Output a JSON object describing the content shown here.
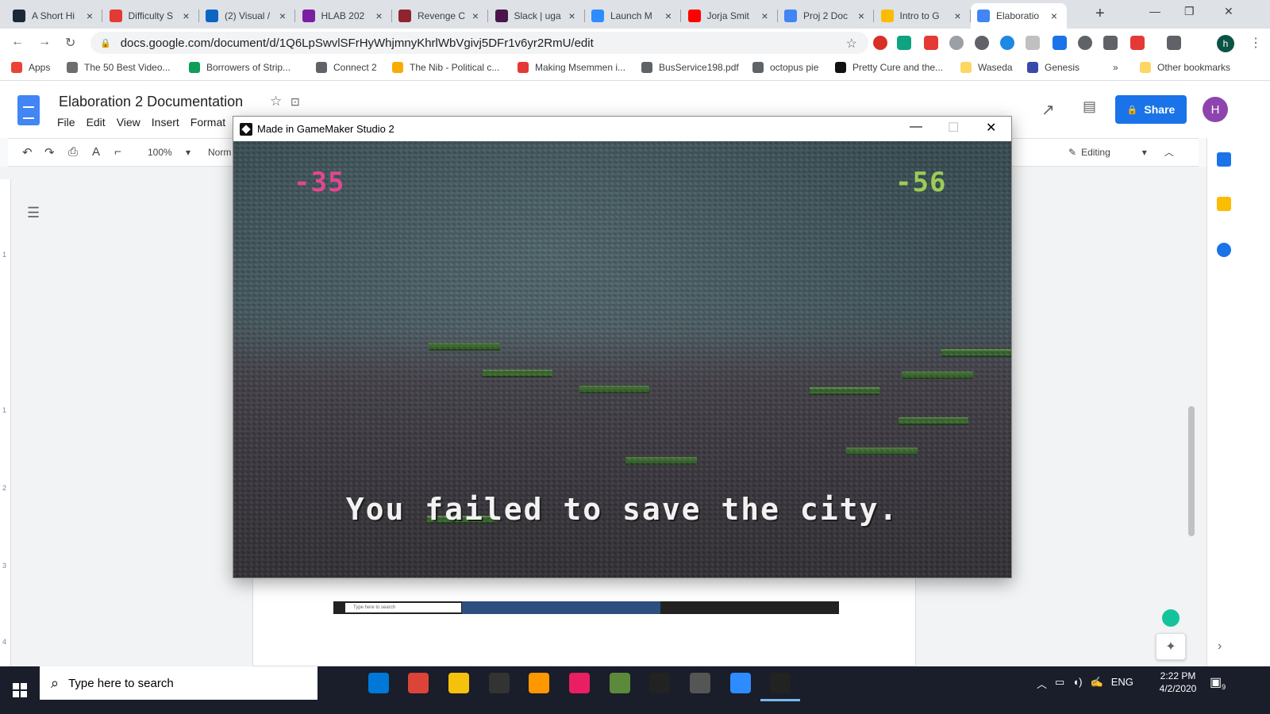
{
  "browser": {
    "tabs": [
      {
        "label": "A Short Hi",
        "icon": "steam-icon",
        "color": "#1b2838",
        "active": false
      },
      {
        "label": "Difficulty S",
        "icon": "sketchy-icon",
        "color": "#e53935",
        "active": false
      },
      {
        "label": "(2) Visual /",
        "icon": "linkedin-icon",
        "color": "#0a66c2",
        "active": false
      },
      {
        "label": "HLAB 202",
        "icon": "onenote-icon",
        "color": "#7b1fa2",
        "active": false
      },
      {
        "label": "Revenge C",
        "icon": "bookmark-icon",
        "color": "#8e2430",
        "active": false
      },
      {
        "label": "Slack | uga",
        "icon": "slack-icon",
        "color": "#4a154b",
        "active": false
      },
      {
        "label": "Launch M",
        "icon": "zoom-icon",
        "color": "#2d8cff",
        "active": false
      },
      {
        "label": "Jorja Smit",
        "icon": "youtube-icon",
        "color": "#ff0000",
        "active": false
      },
      {
        "label": "Proj 2 Doc",
        "icon": "docs-icon",
        "color": "#4285f4",
        "active": false
      },
      {
        "label": "Intro to G",
        "icon": "drive-icon",
        "color": "#fbbc04",
        "active": false
      },
      {
        "label": "Elaboratio",
        "icon": "docs-icon",
        "color": "#4285f4",
        "active": true
      }
    ],
    "url": "docs.google.com/document/d/1Q6LpSwvlSFrHyWhjmnyKhrlWbVgivj5DFr1v6yr2RmU/edit",
    "bookmarks": [
      {
        "label": "Apps",
        "color": "#ea4335"
      },
      {
        "label": "The 50 Best Video...",
        "color": "#6d6d6d"
      },
      {
        "label": "Borrowers of Strip...",
        "color": "#0f9d58"
      },
      {
        "label": "Connect 2",
        "color": "#5f6368"
      },
      {
        "label": "The Nib - Political c...",
        "color": "#f9ab00"
      },
      {
        "label": "Making Msemmen i...",
        "color": "#e53935"
      },
      {
        "label": "BusService198.pdf",
        "color": "#5f6368"
      },
      {
        "label": "octopus pie",
        "color": "#5f6368"
      },
      {
        "label": "Pretty Cure and the...",
        "color": "#111111"
      },
      {
        "label": "Waseda",
        "color": "#fdd663"
      },
      {
        "label": "Genesis",
        "color": "#3949ab"
      }
    ],
    "bookmarks_more": "»",
    "other_bookmarks": "Other bookmarks",
    "profile_initial": "h"
  },
  "docs": {
    "title": "Elaboration 2 Documentation",
    "menu": [
      "File",
      "Edit",
      "View",
      "Insert",
      "Format"
    ],
    "zoom": "100%",
    "style": "Norm",
    "mode": "Editing",
    "share_label": "Share",
    "avatar_initial": "H",
    "ruler_numbers": [
      "1",
      "1",
      "2",
      "3",
      "4"
    ],
    "embedded_search_placeholder": "Type here to search"
  },
  "game": {
    "window_title": "Made in GameMaker Studio 2",
    "score_left": "-35",
    "score_right": "-56",
    "message": "You failed to save the city.",
    "colors": {
      "score_left": "#e0488f",
      "score_right": "#9ccc55"
    }
  },
  "taskbar": {
    "search_placeholder": "Type here to search",
    "apps": [
      {
        "name": "task-view-icon",
        "color": "transparent"
      },
      {
        "name": "edge-icon",
        "color": "#0078d7"
      },
      {
        "name": "chrome-icon",
        "color": "#db4437"
      },
      {
        "name": "file-explorer-icon",
        "color": "#f4c20d"
      },
      {
        "name": "p-app-icon",
        "color": "#333333"
      },
      {
        "name": "sublime-icon",
        "color": "#ff9800"
      },
      {
        "name": "color-wheel-icon",
        "color": "#e91e63"
      },
      {
        "name": "minecraft-icon",
        "color": "#5d8a3a"
      },
      {
        "name": "gamemaker-icon",
        "color": "#222222"
      },
      {
        "name": "calculator-icon",
        "color": "#555555"
      },
      {
        "name": "zoom-icon",
        "color": "#2d8cff"
      },
      {
        "name": "gamemaker-running-icon",
        "color": "#222222"
      }
    ],
    "language": "ENG",
    "time": "2:22 PM",
    "date": "4/2/2020",
    "notifications": "9"
  }
}
